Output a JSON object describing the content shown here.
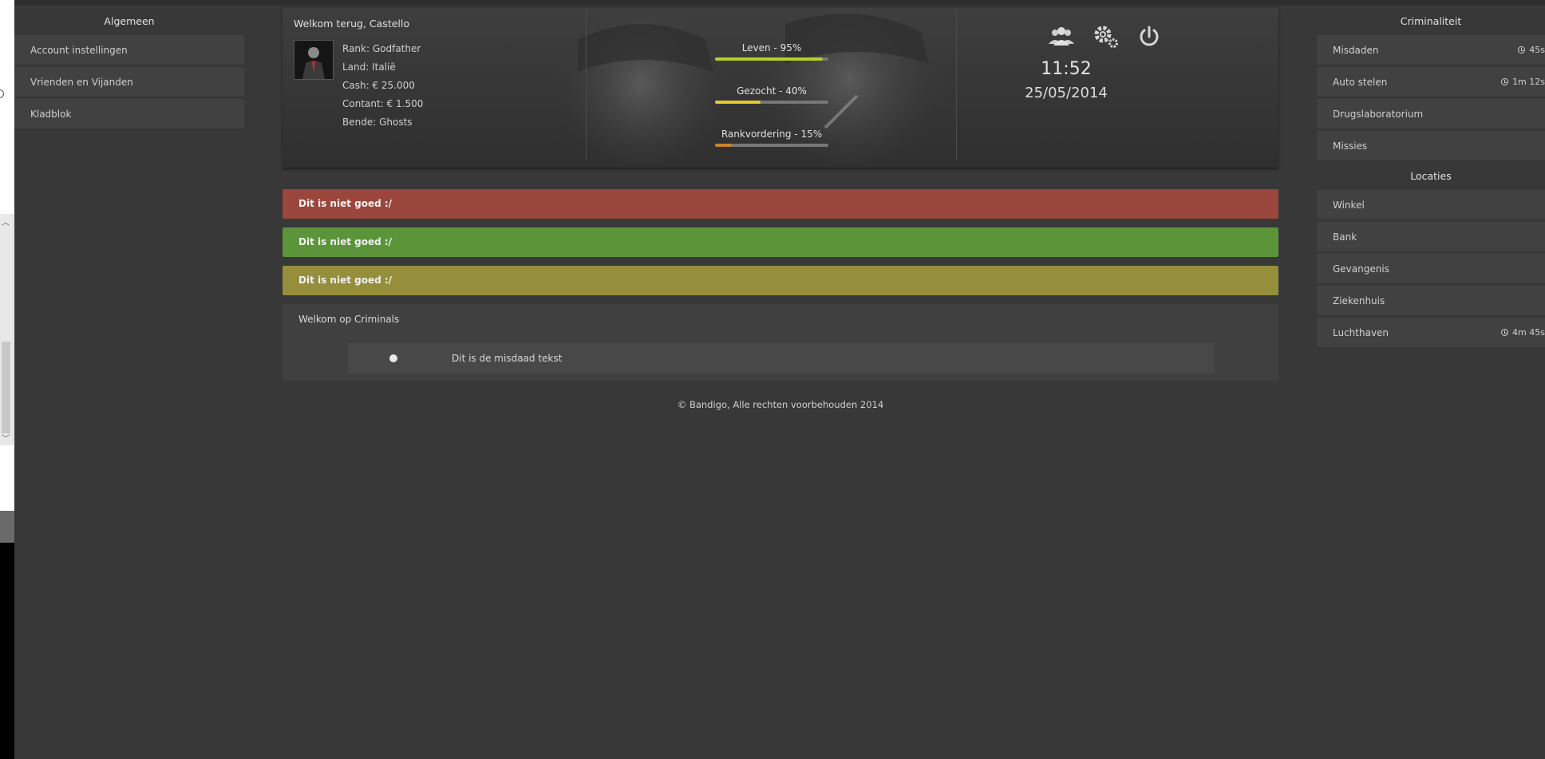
{
  "sidebar_left": {
    "title": "Algemeen",
    "items": [
      {
        "label": "Account instellingen"
      },
      {
        "label": "Vrienden en Vijanden"
      },
      {
        "label": "Kladblok"
      }
    ]
  },
  "header": {
    "welcome": "Welkom terug, Castello",
    "stats": {
      "rank": "Rank: Godfather",
      "land": "Land: Italië",
      "cash": "Cash: € 25.000",
      "contant": "Contant: € 1.500",
      "bende": "Bende: Ghosts"
    },
    "bars": [
      {
        "label": "Leven - 95%",
        "value": 95,
        "color": "#b3d229"
      },
      {
        "label": "Gezocht - 40%",
        "value": 40,
        "color": "#e0cc2a"
      },
      {
        "label": "Rankvordering - 15%",
        "value": 15,
        "color": "#c9832c"
      }
    ],
    "icons": [
      "users-icon",
      "gears-icon",
      "power-icon"
    ],
    "time": "11:52",
    "date": "25/05/2014"
  },
  "alerts": [
    {
      "text": "Dit is niet goed :/",
      "color": "#9a463c"
    },
    {
      "text": "Dit is niet goed :/",
      "color": "#5b9439"
    },
    {
      "text": "Dit is niet goed :/",
      "color": "#958f3c"
    }
  ],
  "main": {
    "title": "Welkom op Criminals",
    "crime_text": "Dit is de misdaad tekst"
  },
  "footer": "© Bandigo, Alle rechten voorbehouden 2014",
  "sidebar_right": {
    "section1_title": "Criminaliteit",
    "section1_items": [
      {
        "label": "Misdaden",
        "timer": "45s"
      },
      {
        "label": "Auto stelen",
        "timer": "1m 12s"
      },
      {
        "label": "Drugslaboratorium"
      },
      {
        "label": "Missies"
      }
    ],
    "section2_title": "Locaties",
    "section2_items": [
      {
        "label": "Winkel"
      },
      {
        "label": "Bank"
      },
      {
        "label": "Gevangenis"
      },
      {
        "label": "Ziekenhuis"
      },
      {
        "label": "Luchthaven",
        "timer": "4m 45s"
      }
    ]
  }
}
